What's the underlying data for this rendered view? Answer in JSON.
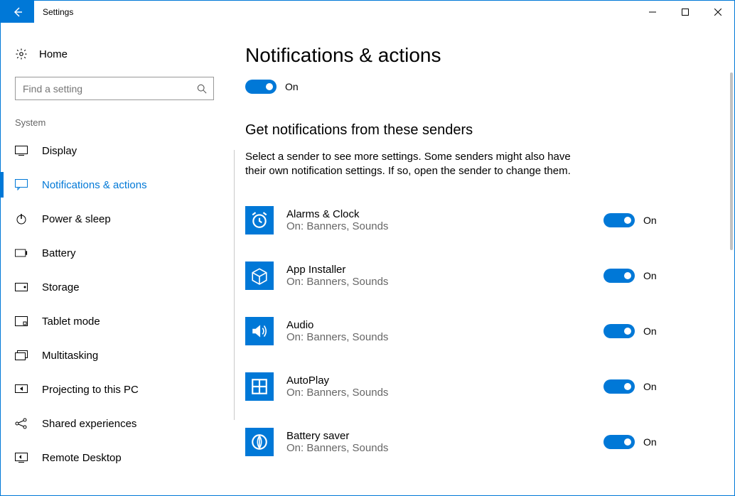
{
  "window": {
    "title": "Settings"
  },
  "sidebar": {
    "home_label": "Home",
    "search_placeholder": "Find a setting",
    "group_label": "System",
    "items": [
      {
        "label": "Display",
        "icon": "display"
      },
      {
        "label": "Notifications & actions",
        "icon": "notifications",
        "active": true
      },
      {
        "label": "Power & sleep",
        "icon": "power"
      },
      {
        "label": "Battery",
        "icon": "battery"
      },
      {
        "label": "Storage",
        "icon": "storage"
      },
      {
        "label": "Tablet mode",
        "icon": "tablet"
      },
      {
        "label": "Multitasking",
        "icon": "multitasking"
      },
      {
        "label": "Projecting to this PC",
        "icon": "projecting"
      },
      {
        "label": "Shared experiences",
        "icon": "shared"
      },
      {
        "label": "Remote Desktop",
        "icon": "remote"
      }
    ]
  },
  "main": {
    "heading": "Notifications & actions",
    "master_toggle_label": "On",
    "section_heading": "Get notifications from these senders",
    "section_desc": "Select a sender to see more settings. Some senders might also have their own notification settings. If so, open the sender to change them.",
    "senders": [
      {
        "name": "Alarms & Clock",
        "sub": "On: Banners, Sounds",
        "state": "On",
        "icon": "clock"
      },
      {
        "name": "App Installer",
        "sub": "On: Banners, Sounds",
        "state": "On",
        "icon": "box"
      },
      {
        "name": "Audio",
        "sub": "On: Banners, Sounds",
        "state": "On",
        "icon": "speaker"
      },
      {
        "name": "AutoPlay",
        "sub": "On: Banners, Sounds",
        "state": "On",
        "icon": "grid"
      },
      {
        "name": "Battery saver",
        "sub": "On: Banners, Sounds",
        "state": "On",
        "icon": "leaf"
      }
    ]
  }
}
